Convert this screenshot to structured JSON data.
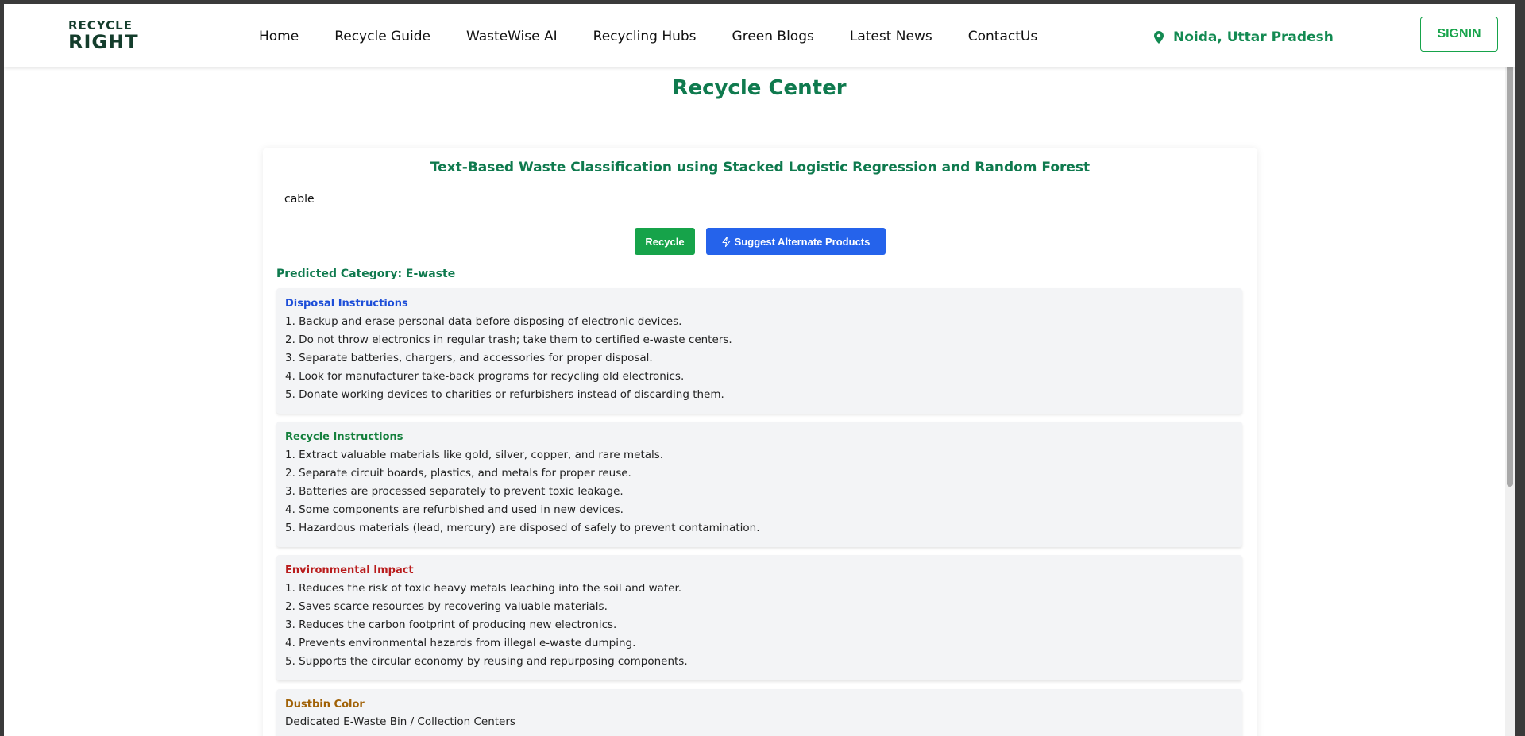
{
  "logo": {
    "line1": "RECYCLE",
    "line2": "RIGHT"
  },
  "nav": [
    "Home",
    "Recycle Guide",
    "WasteWise AI",
    "Recycling Hubs",
    "Green Blogs",
    "Latest News",
    "ContactUs"
  ],
  "location": "Noida, Uttar Pradesh",
  "signin_label": "SIGNIN",
  "page_title": "Recycle Center",
  "card": {
    "title": "Text-Based Waste Classification using Stacked Logistic Regression and Random Forest",
    "query_value": "cable",
    "recycle_button": "Recycle",
    "suggest_button": "Suggest Alternate Products",
    "predicted": "Predicted Category: E-waste"
  },
  "sections": {
    "disposal": {
      "title": "Disposal Instructions",
      "color": "#1d4ed8",
      "items": [
        "1. Backup and erase personal data before disposing of electronic devices.",
        "2. Do not throw electronics in regular trash; take them to certified e-waste centers.",
        "3. Separate batteries, chargers, and accessories for proper disposal.",
        "4. Look for manufacturer take-back programs for recycling old electronics.",
        "5. Donate working devices to charities or refurbishers instead of discarding them."
      ]
    },
    "recycle": {
      "title": "Recycle Instructions",
      "color": "#15803d",
      "items": [
        "1. Extract valuable materials like gold, silver, copper, and rare metals.",
        "2. Separate circuit boards, plastics, and metals for proper reuse.",
        "3. Batteries are processed separately to prevent toxic leakage.",
        "4. Some components are refurbished and used in new devices.",
        "5. Hazardous materials (lead, mercury) are disposed of safely to prevent contamination."
      ]
    },
    "environmental": {
      "title": "Environmental Impact",
      "color": "#b91c1c",
      "items": [
        "1. Reduces the risk of toxic heavy metals leaching into the soil and water.",
        "2. Saves scarce resources by recovering valuable materials.",
        "3. Reduces the carbon footprint of producing new electronics.",
        "4. Prevents environmental hazards from illegal e-waste dumping.",
        "5. Supports the circular economy by reusing and repurposing components."
      ]
    },
    "dustbin": {
      "title": "Dustbin Color",
      "color": "#a16207",
      "value": "Dedicated E-Waste Bin / Collection Centers"
    }
  },
  "icons": {
    "location": "map-pin-icon",
    "suggest": "lightning-icon"
  },
  "colors": {
    "brand_green": "#16a34a",
    "title_green": "#0f7a4e",
    "primary_blue": "#2563eb"
  }
}
